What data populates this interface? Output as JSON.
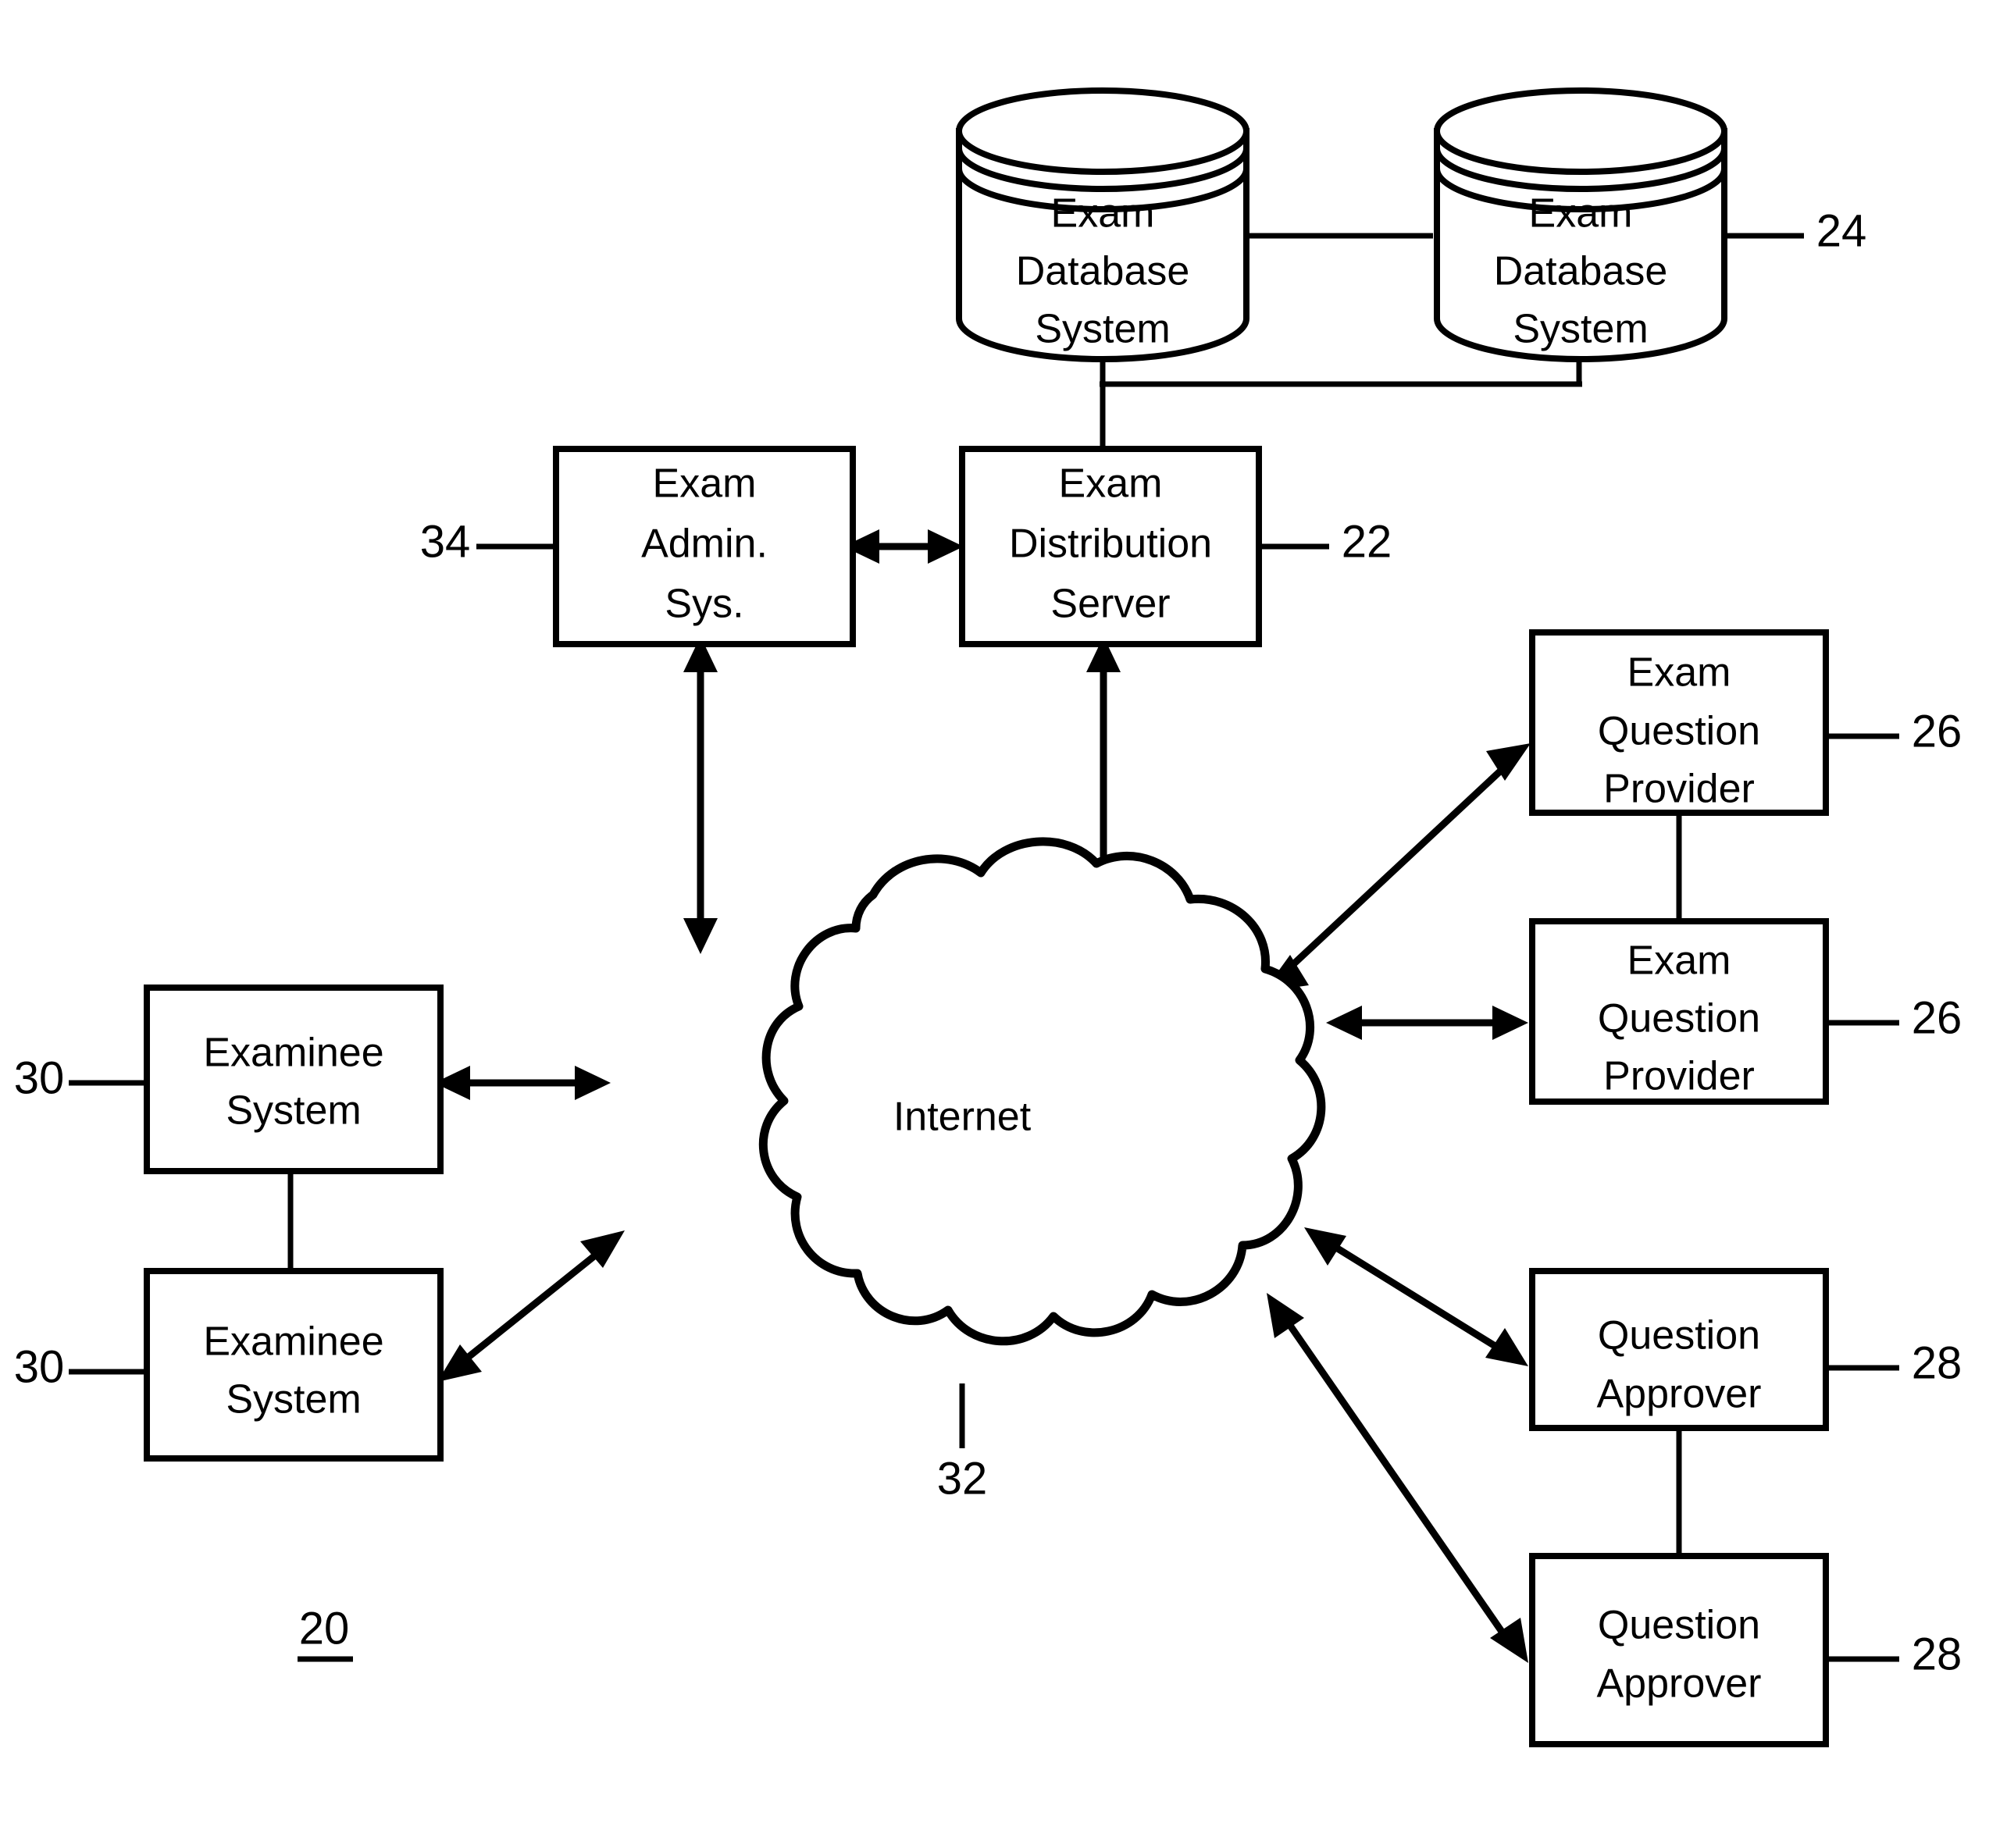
{
  "figure": {
    "number_label": "20",
    "network_label": "Internet",
    "network_ref": "32"
  },
  "nodes": {
    "db_left": {
      "lines": [
        "Exam",
        "Database",
        "System"
      ],
      "ref": ""
    },
    "db_right": {
      "lines": [
        "Exam",
        "Database",
        "System"
      ],
      "ref": "24"
    },
    "exam_admin": {
      "lines": [
        "Exam",
        "Admin.",
        "Sys."
      ],
      "ref": "34"
    },
    "exam_dist": {
      "lines": [
        "Exam",
        "Distribution",
        "Server"
      ],
      "ref": "22"
    },
    "examinee_top": {
      "lines": [
        "Examinee",
        "System"
      ],
      "ref": "30"
    },
    "examinee_bottom": {
      "lines": [
        "Examinee",
        "System"
      ],
      "ref": "30"
    },
    "provider_top": {
      "lines": [
        "Exam",
        "Question",
        "Provider"
      ],
      "ref": "26"
    },
    "provider_bottom": {
      "lines": [
        "Exam",
        "Question",
        "Provider"
      ],
      "ref": "26"
    },
    "approver_top": {
      "lines": [
        "Question",
        "Approver"
      ],
      "ref": "28"
    },
    "approver_bottom": {
      "lines": [
        "Question",
        "Approver"
      ],
      "ref": "28"
    }
  },
  "colors": {
    "ink": "#000000",
    "paper": "#ffffff"
  }
}
